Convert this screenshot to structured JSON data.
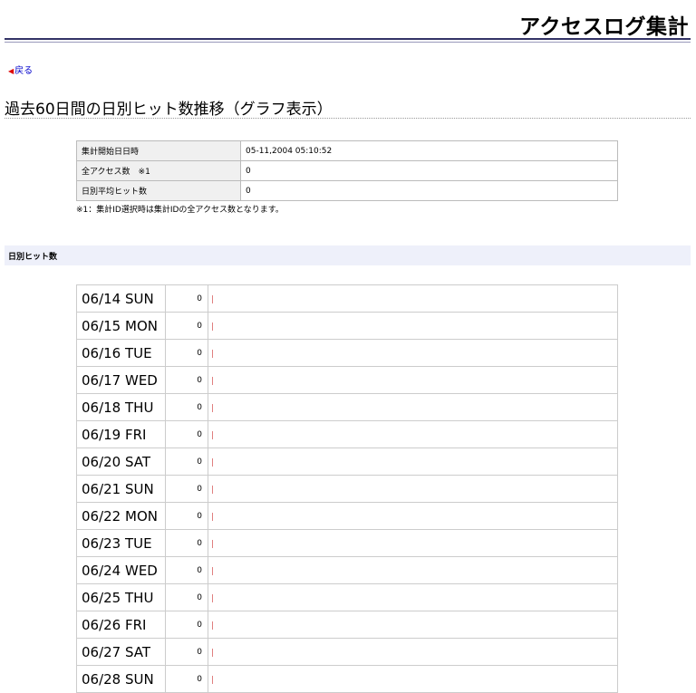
{
  "header": {
    "title": "アクセスログ集計"
  },
  "nav": {
    "back_label": "戻る"
  },
  "page": {
    "title": "過去60日間の日別ヒット数推移（グラフ表示）"
  },
  "summary": {
    "rows": [
      {
        "label": "集計開始日日時",
        "value": "05-11,2004 05:10:52"
      },
      {
        "label": "全アクセス数　※1",
        "value": "0"
      },
      {
        "label": "日別平均ヒット数",
        "value": "0"
      }
    ],
    "note": "※1：集計ID選択時は集計IDの全アクセス数となります。"
  },
  "section": {
    "title": "日別ヒット数"
  },
  "daily": [
    {
      "date": "06/14 SUN",
      "count": "0"
    },
    {
      "date": "06/15 MON",
      "count": "0"
    },
    {
      "date": "06/16 TUE",
      "count": "0"
    },
    {
      "date": "06/17 WED",
      "count": "0"
    },
    {
      "date": "06/18 THU",
      "count": "0"
    },
    {
      "date": "06/19 FRI",
      "count": "0"
    },
    {
      "date": "06/20 SAT",
      "count": "0"
    },
    {
      "date": "06/21 SUN",
      "count": "0"
    },
    {
      "date": "06/22 MON",
      "count": "0"
    },
    {
      "date": "06/23 TUE",
      "count": "0"
    },
    {
      "date": "06/24 WED",
      "count": "0"
    },
    {
      "date": "06/25 THU",
      "count": "0"
    },
    {
      "date": "06/26 FRI",
      "count": "0"
    },
    {
      "date": "06/27 SAT",
      "count": "0"
    },
    {
      "date": "06/28 SUN",
      "count": "0"
    }
  ]
}
